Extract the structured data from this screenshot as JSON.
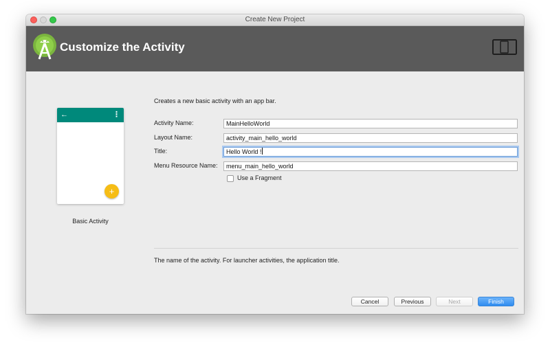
{
  "window": {
    "title": "Create New Project"
  },
  "header": {
    "title": "Customize the Activity"
  },
  "template": {
    "name": "Basic Activity"
  },
  "form": {
    "description": "Creates a new basic activity with an app bar.",
    "fields": [
      {
        "label": "Activity Name:",
        "value": "MainHelloWorld"
      },
      {
        "label": "Layout Name:",
        "value": "activity_main_hello_world"
      },
      {
        "label": "Title:",
        "value": "Hello World !"
      },
      {
        "label": "Menu Resource Name:",
        "value": "menu_main_hello_world"
      }
    ],
    "fragment_checkbox": {
      "label": "Use a Fragment",
      "checked": false
    },
    "help_text": "The name of the activity. For launcher activities, the application title."
  },
  "buttons": {
    "cancel": "Cancel",
    "previous": "Previous",
    "next": "Next",
    "finish": "Finish"
  },
  "icons": {
    "logo": "android-studio-logo-icon",
    "device": "device-form-factor-icon",
    "back": "arrow-back-icon",
    "overflow": "overflow-menu-icon",
    "fab": "plus-icon"
  },
  "colors": {
    "header_bg": "#5a5a5a",
    "app_bar": "#00897b",
    "fab": "#f6bd16",
    "primary_button": "#2f8cf0"
  }
}
